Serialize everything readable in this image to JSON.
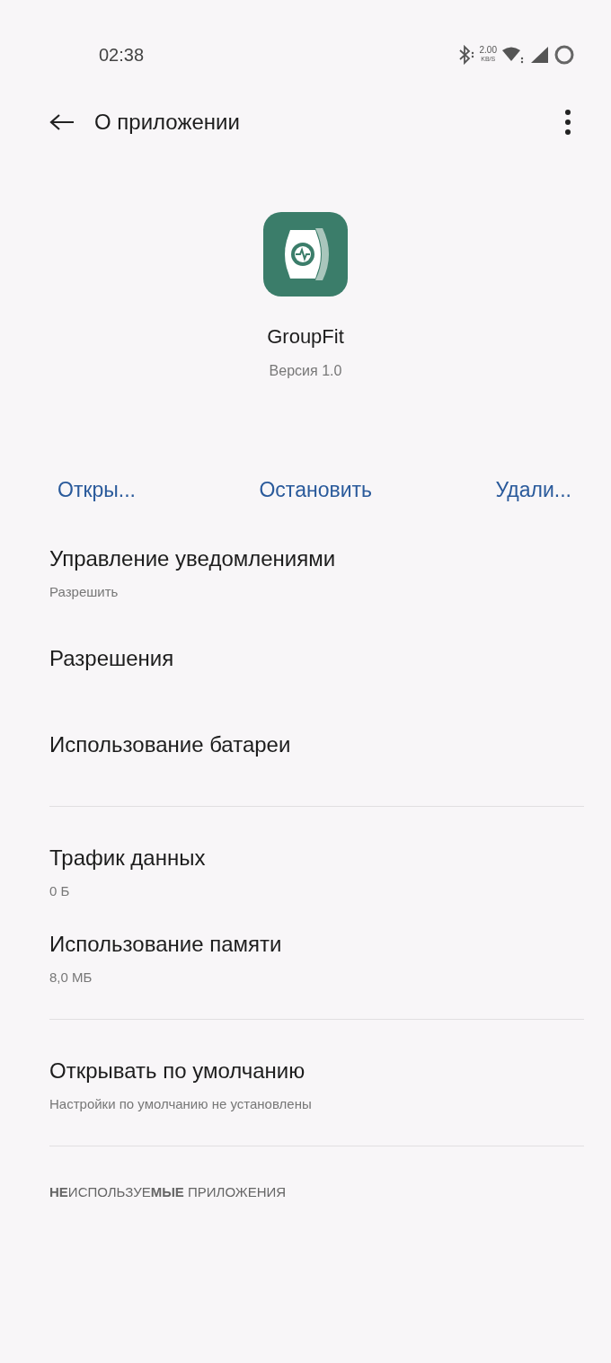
{
  "status_bar": {
    "time": "02:38",
    "speed": "2.00",
    "speed_unit": "KB/S"
  },
  "toolbar": {
    "title": "О приложении"
  },
  "app": {
    "name": "GroupFit",
    "version": "Версия 1.0"
  },
  "actions": [
    {
      "label": "Откры..."
    },
    {
      "label": "Остановить"
    },
    {
      "label": "Удали..."
    }
  ],
  "sections": [
    {
      "items": [
        {
          "title": "Управление уведомлениями",
          "subtitle": "Разрешить"
        },
        {
          "title": "Разрешения"
        },
        {
          "title": "Использование батареи"
        }
      ]
    },
    {
      "items": [
        {
          "title": "Трафик данных",
          "subtitle": "0 Б"
        },
        {
          "title": "Использование памяти",
          "subtitle": "8,0 МБ"
        }
      ]
    },
    {
      "items": [
        {
          "title": "Открывать по умолчанию",
          "subtitle": "Настройки по умолчанию не установлены"
        }
      ]
    }
  ],
  "section_header": "**НЕ**ИСПОЛЬЗУЕ**МЫЕ** ПРИЛОЖЕНИЯ"
}
